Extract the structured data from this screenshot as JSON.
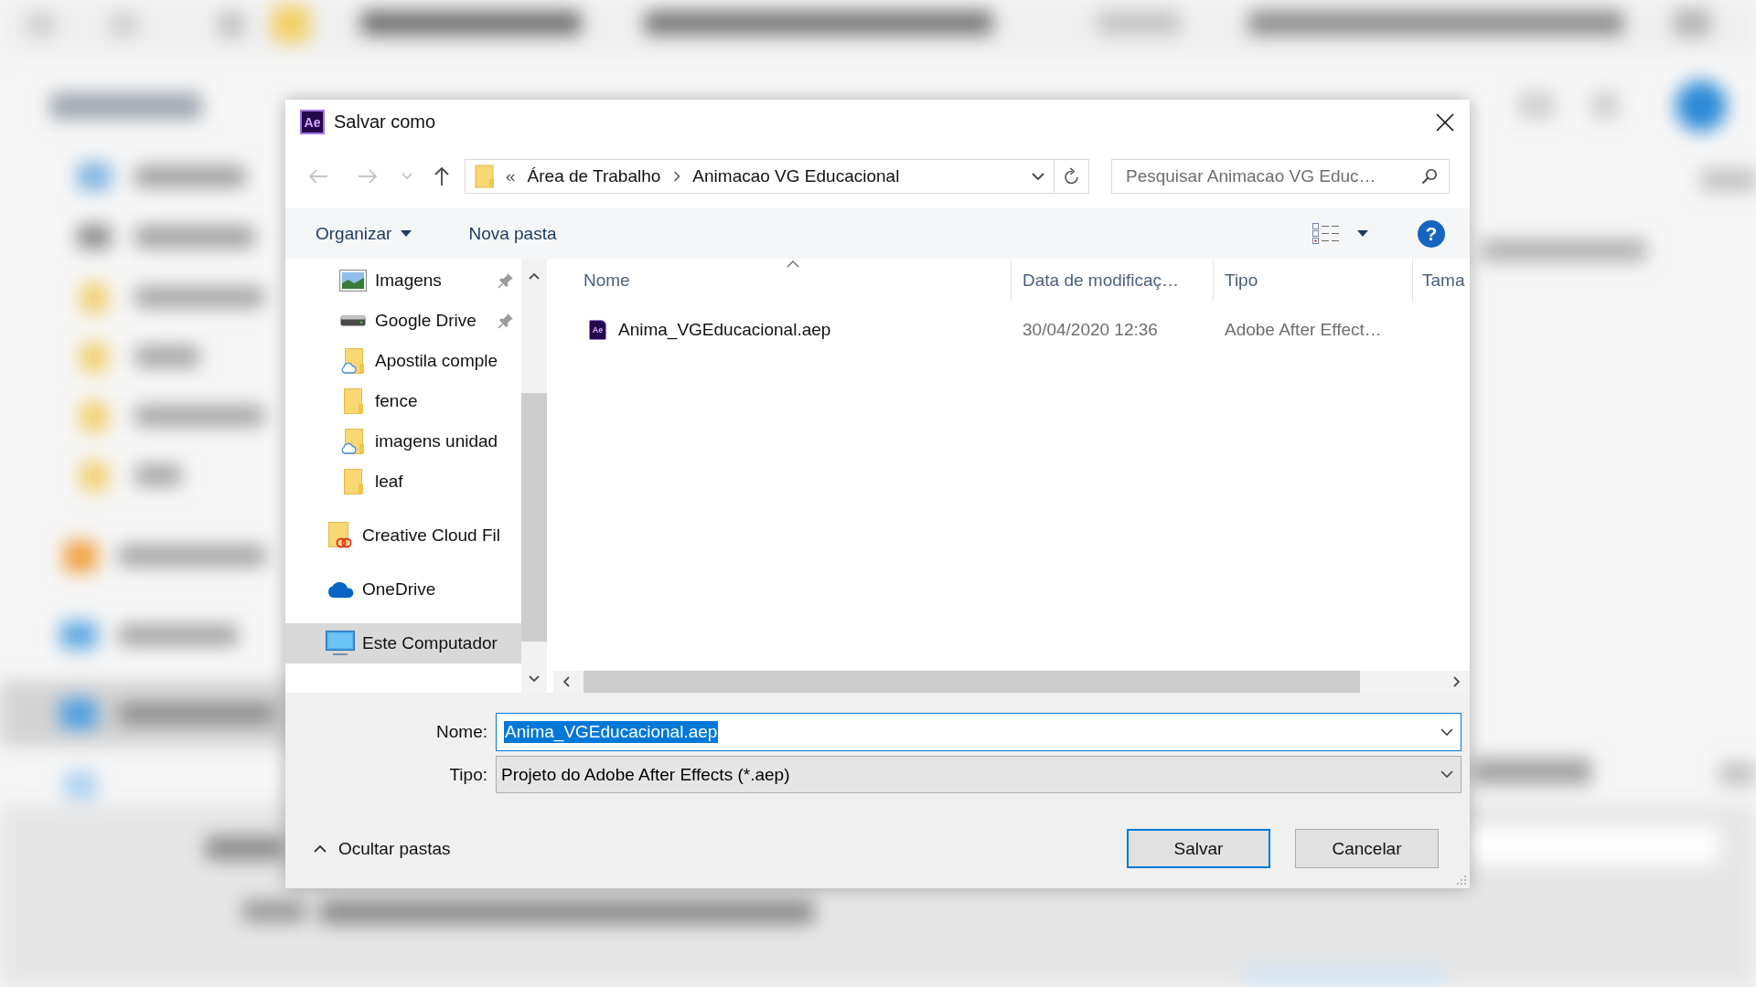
{
  "window": {
    "app_logo": "Ae",
    "title": "Salvar como"
  },
  "nav": {
    "buttons": [
      {
        "kind": "back",
        "disabled": true
      },
      {
        "kind": "forward",
        "disabled": true
      },
      {
        "kind": "recent",
        "disabled": true
      },
      {
        "kind": "up",
        "disabled": false
      }
    ]
  },
  "address_bar": {
    "overflow": "«",
    "segments": [
      "Área de Trabalho",
      "Animacao VG Educacional"
    ]
  },
  "search": {
    "placeholder": "Pesquisar Animacao VG Educ…"
  },
  "toolbar": {
    "buttons": [
      {
        "label": "Organizar",
        "has_menu": true
      },
      {
        "label": "Nova pasta",
        "has_menu": false
      }
    ],
    "help": "?"
  },
  "sidebar": {
    "items": [
      {
        "children": [
          {
            "label": "Imagens",
            "kind": "pictures",
            "pinned": true,
            "selected": false
          },
          {
            "label": "Google Drive",
            "kind": "drive",
            "pinned": true,
            "selected": false
          },
          {
            "label": "Apostila comple",
            "kind": "cloud-folder",
            "pinned": false,
            "selected": false
          },
          {
            "label": "fence",
            "kind": "folder",
            "pinned": false,
            "selected": false
          },
          {
            "label": "imagens unidad",
            "kind": "cloud-folder",
            "pinned": false,
            "selected": false
          },
          {
            "label": "leaf",
            "kind": "folder",
            "pinned": false,
            "selected": false
          }
        ]
      },
      {
        "label": "Creative Cloud Fil",
        "kind": "cc-folder",
        "pinned": false,
        "selected": false
      },
      {
        "label": "OneDrive",
        "kind": "onedrive",
        "pinned": false,
        "selected": false
      },
      {
        "label": "Este Computador",
        "kind": "computer",
        "pinned": false,
        "selected": true
      }
    ]
  },
  "file_list": {
    "columns": [
      {
        "label": "Nome",
        "sorted": true
      },
      {
        "label": "Data de modificaç…",
        "sorted": false
      },
      {
        "label": "Tipo",
        "sorted": false
      },
      {
        "label": "Tama",
        "sorted": false
      }
    ],
    "rows": [
      {
        "icon_text": "Ae",
        "name": "Anima_VGEducacional.aep",
        "modified": "30/04/2020 12:36",
        "type": "Adobe After Effect…",
        "selected": false
      }
    ]
  },
  "form": {
    "filename": {
      "label": "Nome:",
      "value": "Anima_VGEducacional.aep",
      "text_selected": true
    },
    "filetype": {
      "label": "Tipo:",
      "value": "Projeto do Adobe After Effects (*.aep)"
    }
  },
  "footer": {
    "hide_folders": "Ocultar pastas",
    "buttons": [
      {
        "label": "Salvar",
        "default": true
      },
      {
        "label": "Cancelar",
        "default": false
      }
    ]
  }
}
